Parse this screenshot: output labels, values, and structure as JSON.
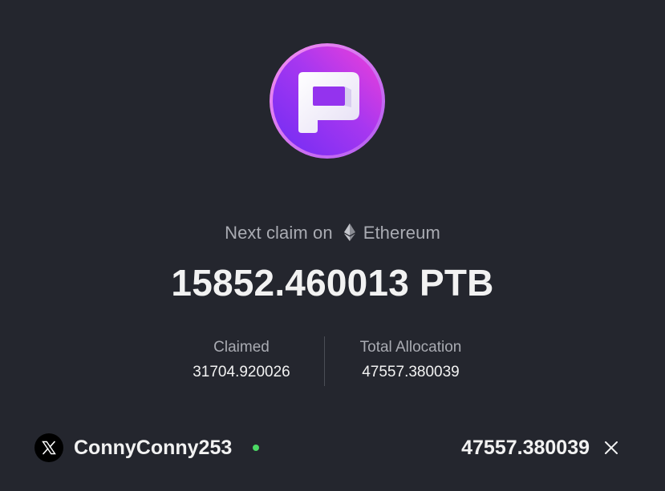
{
  "colors": {
    "background": "#24262e",
    "text_primary": "#f2f2f2",
    "text_secondary": "#a9abb2",
    "divider": "#4a4d55",
    "online": "#4cd964",
    "logo_gradient_start": "#8b2cf5",
    "logo_gradient_end": "#e83adf"
  },
  "logo": {
    "icon": "ptb-token-logo-icon"
  },
  "claim": {
    "prefix": "Next claim on",
    "network_icon": "ethereum-icon",
    "network": "Ethereum",
    "amount": "15852.460013 PTB"
  },
  "stats": {
    "claimed_label": "Claimed",
    "claimed_value": "31704.920026",
    "total_label": "Total Allocation",
    "total_value": "47557.380039"
  },
  "footer": {
    "avatar_icon": "x-logo-icon",
    "username": "ConnyConny253",
    "status_icon": "online-status-dot",
    "amount": "47557.380039",
    "close_icon": "close-icon"
  }
}
